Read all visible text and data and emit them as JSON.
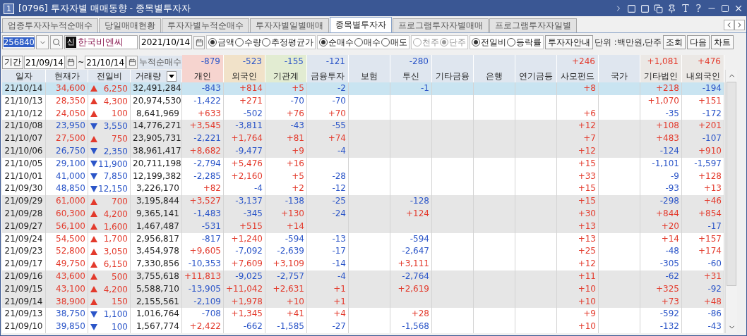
{
  "window": {
    "badge": "1",
    "title": "[0796] 투자자별 매매동향 - 종목별투자자",
    "glyph_buttons": [
      "T",
      "?"
    ]
  },
  "tabs": [
    {
      "label": "업종투자자누적순매수",
      "selected": false
    },
    {
      "label": "당일매매현황",
      "selected": false
    },
    {
      "label": "투자자별누적순매수",
      "selected": false
    },
    {
      "label": "투자자별일별매매",
      "selected": false
    },
    {
      "label": "종목별투자자",
      "selected": true
    },
    {
      "label": "프로그램투자자별매매",
      "selected": false
    },
    {
      "label": "프로그램투자자일별",
      "selected": false
    }
  ],
  "toolbar": {
    "code": "256840",
    "badge": "신",
    "name": "한국비엔씨",
    "date": "2021/10/14",
    "radio_groups": [
      {
        "disabled": false,
        "options": [
          {
            "label": "금액",
            "selected": true
          },
          {
            "label": "수량",
            "selected": false
          },
          {
            "label": "추정평균가",
            "selected": false
          }
        ]
      },
      {
        "disabled": false,
        "options": [
          {
            "label": "순매수",
            "selected": true
          },
          {
            "label": "매수",
            "selected": false
          },
          {
            "label": "매도",
            "selected": false
          }
        ]
      },
      {
        "disabled": true,
        "options": [
          {
            "label": "천주",
            "selected": false
          },
          {
            "label": "단주",
            "selected": true
          }
        ]
      },
      {
        "disabled": false,
        "options": [
          {
            "label": "전일비",
            "selected": true
          },
          {
            "label": "등락률",
            "selected": false
          }
        ]
      }
    ],
    "guide_button": "투자자안내",
    "unit": "단위 :백만원,단주",
    "buttons": [
      "조회",
      "다음",
      "차트"
    ]
  },
  "period": {
    "button": "기간",
    "from": "21/09/14",
    "separator": "~",
    "to": "21/10/14",
    "label": "누적순매수",
    "totals": {
      "individual": "-879",
      "foreign": "-523",
      "institution": "-155",
      "financial_investment": "-121",
      "investment_trust": "-280",
      "private_fund": "+246",
      "other_corporation": "+1,081",
      "domestic_foreign": "+476"
    }
  },
  "table": {
    "columns": [
      "일자",
      "현재가",
      "전일비",
      "거래량",
      "개인",
      "외국인",
      "기관계",
      "금융투자",
      "보험",
      "투신",
      "기타금융",
      "은행",
      "연기금등",
      "사모펀드",
      "국가",
      "기타법인",
      "내외국인"
    ],
    "rows": [
      {
        "date": "21/10/14",
        "price": "34,600",
        "rising": true,
        "change": "6,250",
        "volume": "32,491,284",
        "values": {
          "individual": "-843",
          "foreign": "+814",
          "institution": "+5",
          "financial_investment": "-2",
          "investment_trust": "-1",
          "private_fund": "+8",
          "other_corporation": "+218",
          "domestic_foreign": "-194"
        },
        "selected": true
      },
      {
        "date": "21/10/13",
        "price": "28,350",
        "rising": true,
        "change": "4,300",
        "volume": "20,974,530",
        "values": {
          "individual": "-1,422",
          "foreign": "+271",
          "institution": "-70",
          "financial_investment": "-70",
          "other_corporation": "+1,070",
          "domestic_foreign": "+151"
        },
        "shaded": false,
        "selected": false
      },
      {
        "date": "21/10/12",
        "price": "24,050",
        "rising": true,
        "change": "100",
        "volume": "8,641,969",
        "values": {
          "individual": "+633",
          "foreign": "-502",
          "institution": "+76",
          "financial_investment": "+70",
          "private_fund": "+6",
          "other_corporation": "-35",
          "domestic_foreign": "-172"
        },
        "shaded": false,
        "selected": false
      },
      {
        "date": "21/10/08",
        "price": "23,950",
        "rising": false,
        "change": "3,550",
        "volume": "14,776,271",
        "values": {
          "individual": "+3,545",
          "foreign": "-3,811",
          "institution": "-43",
          "financial_investment": "-55",
          "private_fund": "+12",
          "other_corporation": "+108",
          "domestic_foreign": "+201"
        },
        "shaded": true,
        "selected": false
      },
      {
        "date": "21/10/07",
        "price": "27,500",
        "rising": true,
        "change": "750",
        "volume": "23,905,731",
        "values": {
          "individual": "-2,221",
          "foreign": "+1,764",
          "institution": "+81",
          "financial_investment": "+74",
          "private_fund": "+7",
          "other_corporation": "+483",
          "domestic_foreign": "-107"
        },
        "shaded": true,
        "selected": false
      },
      {
        "date": "21/10/06",
        "price": "26,750",
        "rising": false,
        "change": "2,350",
        "volume": "38,961,417",
        "values": {
          "individual": "+8,682",
          "foreign": "-9,477",
          "institution": "+9",
          "financial_investment": "-4",
          "private_fund": "+12",
          "other_corporation": "-124",
          "domestic_foreign": "+910"
        },
        "shaded": true,
        "selected": false
      },
      {
        "date": "21/10/05",
        "price": "29,100",
        "rising": false,
        "change": "11,900",
        "volume": "20,711,198",
        "values": {
          "individual": "-2,794",
          "foreign": "+5,476",
          "institution": "+16",
          "private_fund": "+15",
          "other_corporation": "-1,101",
          "domestic_foreign": "-1,597"
        },
        "shaded": false,
        "selected": false
      },
      {
        "date": "21/10/01",
        "price": "41,000",
        "rising": false,
        "change": "7,850",
        "volume": "12,199,382",
        "values": {
          "individual": "-2,285",
          "foreign": "+2,160",
          "institution": "+5",
          "financial_investment": "-28",
          "private_fund": "+33",
          "other_corporation": "-9",
          "domestic_foreign": "+128"
        },
        "shaded": false,
        "selected": false
      },
      {
        "date": "21/09/30",
        "price": "48,850",
        "rising": false,
        "change": "12,150",
        "volume": "3,226,170",
        "values": {
          "individual": "+82",
          "foreign": "-4",
          "institution": "+2",
          "financial_investment": "-12",
          "private_fund": "+15",
          "other_corporation": "-93",
          "domestic_foreign": "+13"
        },
        "shaded": false,
        "selected": false
      },
      {
        "date": "21/09/29",
        "price": "61,000",
        "rising": true,
        "change": "700",
        "volume": "3,195,844",
        "values": {
          "individual": "+3,527",
          "foreign": "-3,137",
          "institution": "-138",
          "financial_investment": "-25",
          "investment_trust": "-128",
          "private_fund": "+15",
          "other_corporation": "-298",
          "domestic_foreign": "+46"
        },
        "shaded": true,
        "selected": false
      },
      {
        "date": "21/09/28",
        "price": "60,300",
        "rising": true,
        "change": "4,200",
        "volume": "9,365,141",
        "values": {
          "individual": "-1,483",
          "foreign": "-345",
          "institution": "+130",
          "financial_investment": "-24",
          "investment_trust": "+124",
          "private_fund": "+30",
          "other_corporation": "+844",
          "domestic_foreign": "+854"
        },
        "shaded": true,
        "selected": false
      },
      {
        "date": "21/09/27",
        "price": "56,100",
        "rising": true,
        "change": "1,600",
        "volume": "1,467,487",
        "values": {
          "individual": "-531",
          "foreign": "+515",
          "institution": "+14",
          "private_fund": "+13",
          "other_corporation": "+20",
          "domestic_foreign": "-17"
        },
        "shaded": true,
        "selected": false
      },
      {
        "date": "21/09/24",
        "price": "54,500",
        "rising": true,
        "change": "1,700",
        "volume": "2,956,817",
        "values": {
          "individual": "-817",
          "foreign": "+1,240",
          "institution": "-594",
          "financial_investment": "-13",
          "investment_trust": "-594",
          "private_fund": "+13",
          "other_corporation": "+14",
          "domestic_foreign": "+157"
        },
        "shaded": false,
        "selected": false
      },
      {
        "date": "21/09/23",
        "price": "52,800",
        "rising": true,
        "change": "3,050",
        "volume": "3,454,978",
        "values": {
          "individual": "+9,605",
          "foreign": "-7,092",
          "institution": "-2,639",
          "financial_investment": "-17",
          "investment_trust": "-2,647",
          "private_fund": "+25",
          "other_corporation": "-48",
          "domestic_foreign": "+174"
        },
        "shaded": false,
        "selected": false
      },
      {
        "date": "21/09/17",
        "price": "49,750",
        "rising": true,
        "change": "6,150",
        "volume": "7,330,856",
        "values": {
          "individual": "-10,353",
          "foreign": "+7,609",
          "institution": "+3,109",
          "financial_investment": "-14",
          "investment_trust": "+3,111",
          "private_fund": "+12",
          "other_corporation": "-305",
          "domestic_foreign": "-60"
        },
        "shaded": false,
        "selected": false
      },
      {
        "date": "21/09/16",
        "price": "43,600",
        "rising": true,
        "change": "500",
        "volume": "3,755,618",
        "values": {
          "individual": "+11,813",
          "foreign": "-9,025",
          "institution": "-2,757",
          "financial_investment": "-4",
          "investment_trust": "-2,764",
          "private_fund": "+11",
          "other_corporation": "-62",
          "domestic_foreign": "+31"
        },
        "shaded": true,
        "selected": false
      },
      {
        "date": "21/09/15",
        "price": "43,100",
        "rising": true,
        "change": "4,200",
        "volume": "5,588,710",
        "values": {
          "individual": "-13,905",
          "foreign": "+11,042",
          "institution": "+2,631",
          "financial_investment": "+1",
          "investment_trust": "+2,619",
          "private_fund": "+10",
          "other_corporation": "+325",
          "domestic_foreign": "-92"
        },
        "shaded": true,
        "selected": false
      },
      {
        "date": "21/09/14",
        "price": "38,900",
        "rising": true,
        "change": "150",
        "volume": "2,155,561",
        "values": {
          "individual": "-2,109",
          "foreign": "+1,978",
          "institution": "+10",
          "financial_investment": "+1",
          "private_fund": "+10",
          "other_corporation": "+73",
          "domestic_foreign": "+48"
        },
        "shaded": true,
        "selected": false
      },
      {
        "date": "21/09/13",
        "price": "38,750",
        "rising": false,
        "change": "1,100",
        "volume": "1,016,764",
        "values": {
          "individual": "-708",
          "foreign": "+1,345",
          "institution": "+41",
          "financial_investment": "+4",
          "investment_trust": "+28",
          "private_fund": "+9",
          "other_corporation": "-592",
          "domestic_foreign": "-86"
        },
        "shaded": false,
        "selected": false
      },
      {
        "date": "21/09/10",
        "price": "39,850",
        "rising": false,
        "change": "100",
        "volume": "1,567,774",
        "values": {
          "individual": "+2,422",
          "foreign": "-662",
          "institution": "-1,585",
          "financial_investment": "-27",
          "investment_trust": "-1,568",
          "private_fund": "+10",
          "other_corporation": "-132",
          "domestic_foreign": "-43"
        },
        "shaded": false,
        "selected": false
      }
    ]
  }
}
